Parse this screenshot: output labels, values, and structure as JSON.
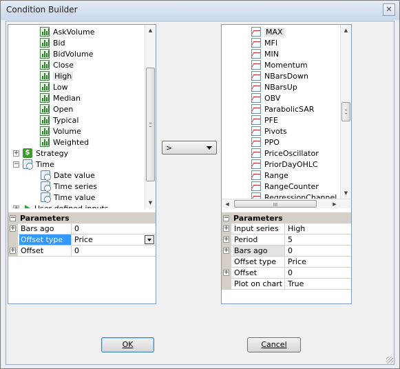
{
  "window": {
    "title": "Condition Builder",
    "close_glyph": "✕"
  },
  "left_tree": {
    "items": [
      {
        "label": "AskVolume",
        "icon": "chart-icon"
      },
      {
        "label": "Bid",
        "icon": "chart-icon"
      },
      {
        "label": "BidVolume",
        "icon": "chart-icon"
      },
      {
        "label": "Close",
        "icon": "chart-icon"
      },
      {
        "label": "High",
        "icon": "chart-icon",
        "selected": true
      },
      {
        "label": "Low",
        "icon": "chart-icon"
      },
      {
        "label": "Median",
        "icon": "chart-icon"
      },
      {
        "label": "Open",
        "icon": "chart-icon"
      },
      {
        "label": "Typical",
        "icon": "chart-icon"
      },
      {
        "label": "Volume",
        "icon": "chart-icon"
      },
      {
        "label": "Weighted",
        "icon": "chart-icon"
      },
      {
        "label": "Strategy",
        "icon": "dollar-icon",
        "expander": "+"
      },
      {
        "label": "Time",
        "icon": "time-icon",
        "expander": "−"
      },
      {
        "label": "Date value",
        "icon": "time-icon"
      },
      {
        "label": "Time series",
        "icon": "time-icon"
      },
      {
        "label": "Time value",
        "icon": "time-icon"
      },
      {
        "label": "User defined inputs",
        "icon": "arrow-icon",
        "expander": "+"
      }
    ]
  },
  "left_params": {
    "header": "Parameters",
    "rows": [
      {
        "name": "Bars ago",
        "value": "0",
        "expander": "+"
      },
      {
        "name": "Offset type",
        "value": "Price",
        "active": true,
        "dropdown": true
      },
      {
        "name": "Offset",
        "value": "0",
        "expander": "+"
      }
    ]
  },
  "operator": {
    "value": ">"
  },
  "right_list": {
    "items": [
      {
        "label": "MAX",
        "selected": true
      },
      {
        "label": "MFI"
      },
      {
        "label": "MIN"
      },
      {
        "label": "Momentum"
      },
      {
        "label": "NBarsDown"
      },
      {
        "label": "NBarsUp"
      },
      {
        "label": "OBV"
      },
      {
        "label": "ParabolicSAR"
      },
      {
        "label": "PFE"
      },
      {
        "label": "Pivots"
      },
      {
        "label": "PPO"
      },
      {
        "label": "PriceOscillator"
      },
      {
        "label": "PriorDayOHLC"
      },
      {
        "label": "Range"
      },
      {
        "label": "RangeCounter"
      },
      {
        "label": "RegressionChannel"
      }
    ],
    "hscroll_grip": "III"
  },
  "right_params": {
    "header": "Parameters",
    "rows": [
      {
        "name": "Input series",
        "value": "High",
        "expander": "+"
      },
      {
        "name": "Period",
        "value": "5",
        "expander": "+"
      },
      {
        "name": "Bars ago",
        "value": "0",
        "expander": "+",
        "shade": true
      },
      {
        "name": "Offset type",
        "value": "Price"
      },
      {
        "name": "Offset",
        "value": "0",
        "expander": "+"
      },
      {
        "name": "Plot on chart",
        "value": "True"
      }
    ]
  },
  "buttons": {
    "ok": "OK",
    "cancel": "Cancel"
  }
}
